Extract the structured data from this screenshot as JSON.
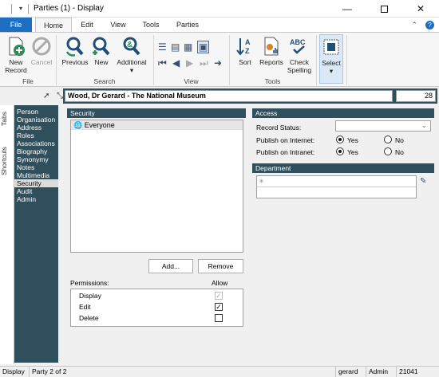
{
  "window": {
    "title": "Parties (1) - Display",
    "qa_arrow": "▾"
  },
  "tabs": [
    "File",
    "Home",
    "Edit",
    "View",
    "Tools",
    "Parties"
  ],
  "ribbon": {
    "file_group": {
      "label": "File",
      "new_record": "New Record",
      "cancel": "Cancel"
    },
    "search_group": {
      "label": "Search",
      "previous": "Previous",
      "new": "New",
      "additional": "Additional"
    },
    "view_group": {
      "label": "View"
    },
    "tools_group": {
      "label": "Tools",
      "sort": "Sort",
      "reports": "Reports",
      "check_spelling": "Check Spelling"
    },
    "select_group": {
      "select": "Select"
    }
  },
  "record": {
    "title": "Wood, Dr Gerard - The National Museum",
    "number": "28"
  },
  "vtabs": [
    "Tabs",
    "Shortcuts"
  ],
  "sidebar": {
    "items": [
      "Person",
      "Organisation",
      "Address",
      "Roles",
      "Associations",
      "Biography",
      "Synonymy",
      "Notes",
      "Multimedia",
      "Security",
      "Audit",
      "Admin"
    ],
    "active_index": 9
  },
  "security": {
    "header": "Security",
    "list": [
      "Everyone"
    ],
    "add_button": "Add...",
    "remove_button": "Remove",
    "permissions_label": "Permissions:",
    "allow_label": "Allow",
    "permissions": [
      {
        "name": "Display",
        "allowed": true,
        "disabled": true
      },
      {
        "name": "Edit",
        "allowed": true,
        "disabled": false
      },
      {
        "name": "Delete",
        "allowed": false,
        "disabled": false
      }
    ]
  },
  "access": {
    "header": "Access",
    "record_status_label": "Record Status:",
    "record_status_value": "",
    "publish_internet_label": "Publish on Internet:",
    "publish_intranet_label": "Publish on Intranet:",
    "yes": "Yes",
    "no": "No",
    "internet": "Yes",
    "intranet": "Yes"
  },
  "department": {
    "header": "Department",
    "row_marker": "✳"
  },
  "status_bar": {
    "mode": "Display",
    "position": "Party 2 of 2",
    "user": "gerard",
    "role": "Admin",
    "number": "21041"
  },
  "colors": {
    "accent": "#1e6fc4",
    "panel": "#2f4f5c",
    "icon_green": "#2e8b57",
    "icon_blue": "#1f4e79"
  }
}
